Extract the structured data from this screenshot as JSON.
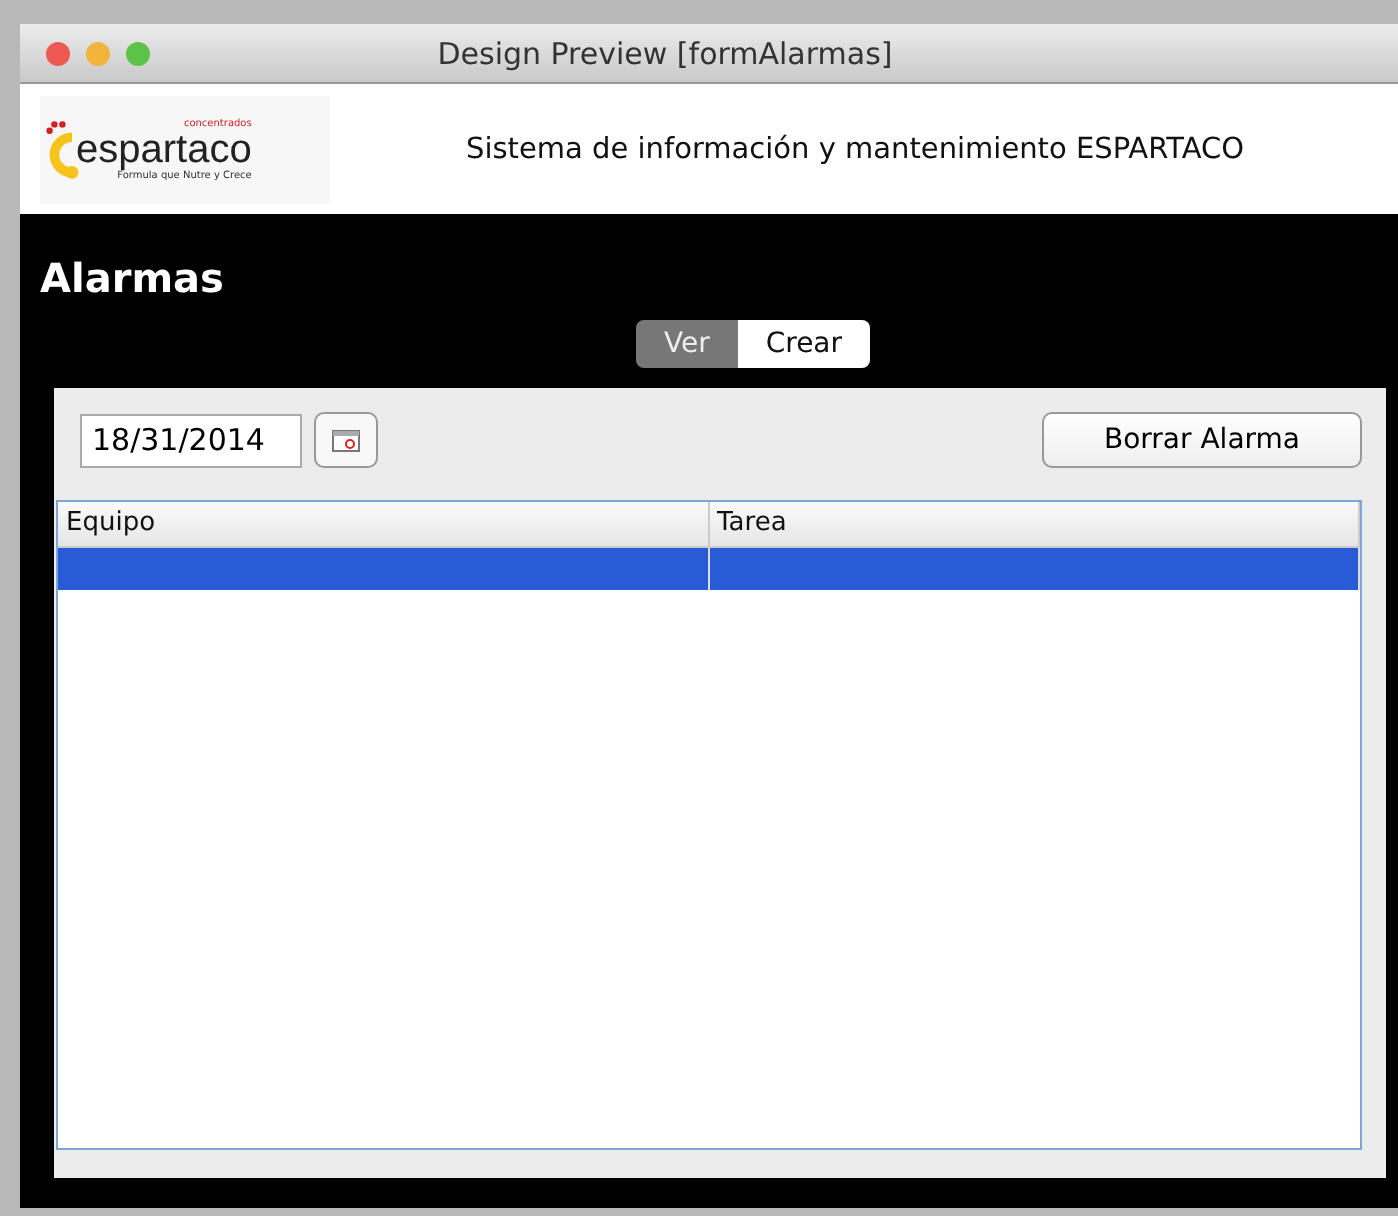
{
  "window": {
    "title": "Design Preview [formAlarmas]"
  },
  "header": {
    "logo": {
      "name": "espartaco",
      "top_text": "concentrados",
      "slogan": "Formula que Nutre y Crece"
    },
    "system_title": "Sistema de información y mantenimiento ESPARTACO"
  },
  "page_title": "Alarmas",
  "view_toggle": [
    {
      "label": "Ver",
      "selected": true
    },
    {
      "label": "Crear",
      "selected": false
    }
  ],
  "date_field": {
    "value": "18/31/2014"
  },
  "delete_button": "Borrar Alarma",
  "table": {
    "columns": [
      "Equipo",
      "Tarea"
    ],
    "rows": [
      {
        "selected": true
      }
    ]
  }
}
